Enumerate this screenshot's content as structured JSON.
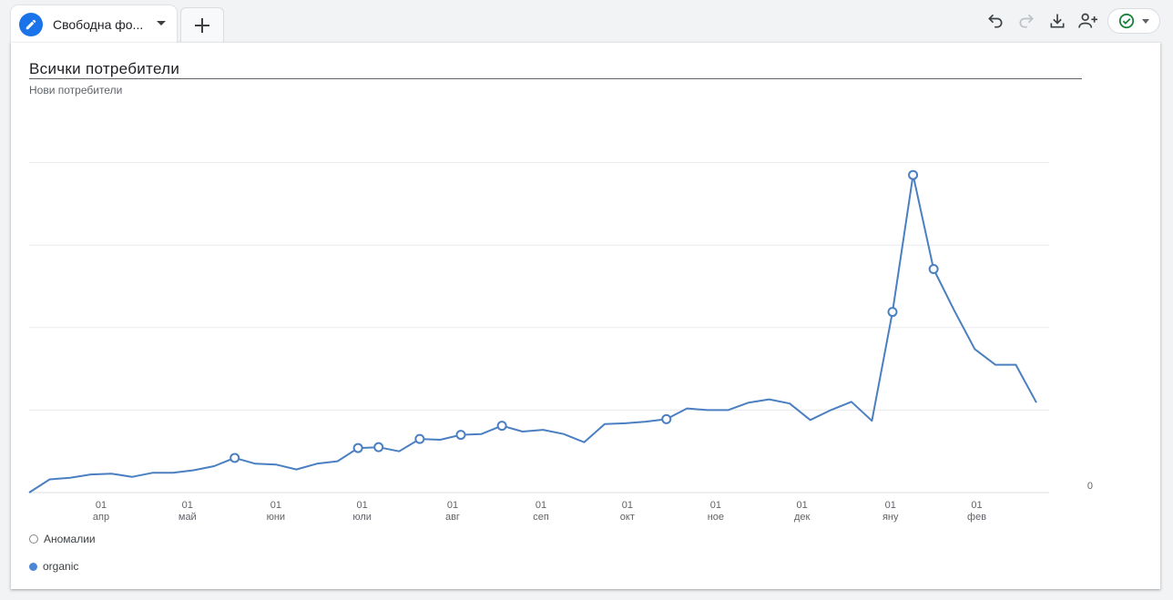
{
  "tabs": {
    "active_tab_label": "Свободна фо..."
  },
  "card": {
    "title": "Всички потребители",
    "subtitle": "Нови потребители"
  },
  "legend": {
    "anomalies_label": "Аномалии",
    "series_label": "organic"
  },
  "colors": {
    "line": "#4a7fc1",
    "accent": "#1a73e8",
    "grid": "#e8eaed",
    "status_ok": "#188038"
  },
  "icons": {
    "tab": "pencil-icon",
    "add": "plus-icon",
    "undo": "undo-icon",
    "redo": "redo-icon",
    "download": "download-icon",
    "share": "add-person-icon",
    "status": "check-circle-icon"
  },
  "chart_data": {
    "type": "line",
    "ytick_labels": [
      "0"
    ],
    "ylim": [
      0,
      5
    ],
    "xtick_labels": [
      {
        "day": "01",
        "month": "апр",
        "index": 3.5
      },
      {
        "day": "01",
        "month": "май",
        "index": 7.7
      },
      {
        "day": "01",
        "month": "юни",
        "index": 12.0
      },
      {
        "day": "01",
        "month": "юли",
        "index": 16.2
      },
      {
        "day": "01",
        "month": "авг",
        "index": 20.6
      },
      {
        "day": "01",
        "month": "сеп",
        "index": 24.9
      },
      {
        "day": "01",
        "month": "окт",
        "index": 29.1
      },
      {
        "day": "01",
        "month": "ное",
        "index": 33.4
      },
      {
        "day": "01",
        "month": "дек",
        "index": 37.6
      },
      {
        "day": "01",
        "month": "яну",
        "index": 41.9
      },
      {
        "day": "01",
        "month": "фев",
        "index": 46.1
      }
    ],
    "grid": true,
    "series": [
      {
        "name": "organic",
        "values": [
          0.0,
          0.16,
          0.18,
          0.22,
          0.23,
          0.19,
          0.24,
          0.24,
          0.27,
          0.32,
          0.42,
          0.35,
          0.34,
          0.28,
          0.35,
          0.38,
          0.54,
          0.55,
          0.5,
          0.65,
          0.64,
          0.7,
          0.71,
          0.81,
          0.74,
          0.76,
          0.71,
          0.61,
          0.83,
          0.84,
          0.86,
          0.89,
          1.02,
          1.0,
          1.0,
          1.09,
          1.13,
          1.08,
          0.88,
          1.0,
          1.1,
          0.87,
          2.19,
          3.85,
          2.71,
          2.21,
          1.74,
          1.55,
          1.55,
          1.09
        ],
        "anomalies": [
          10,
          16,
          17,
          19,
          21,
          23,
          31,
          42,
          43,
          44
        ]
      }
    ]
  }
}
